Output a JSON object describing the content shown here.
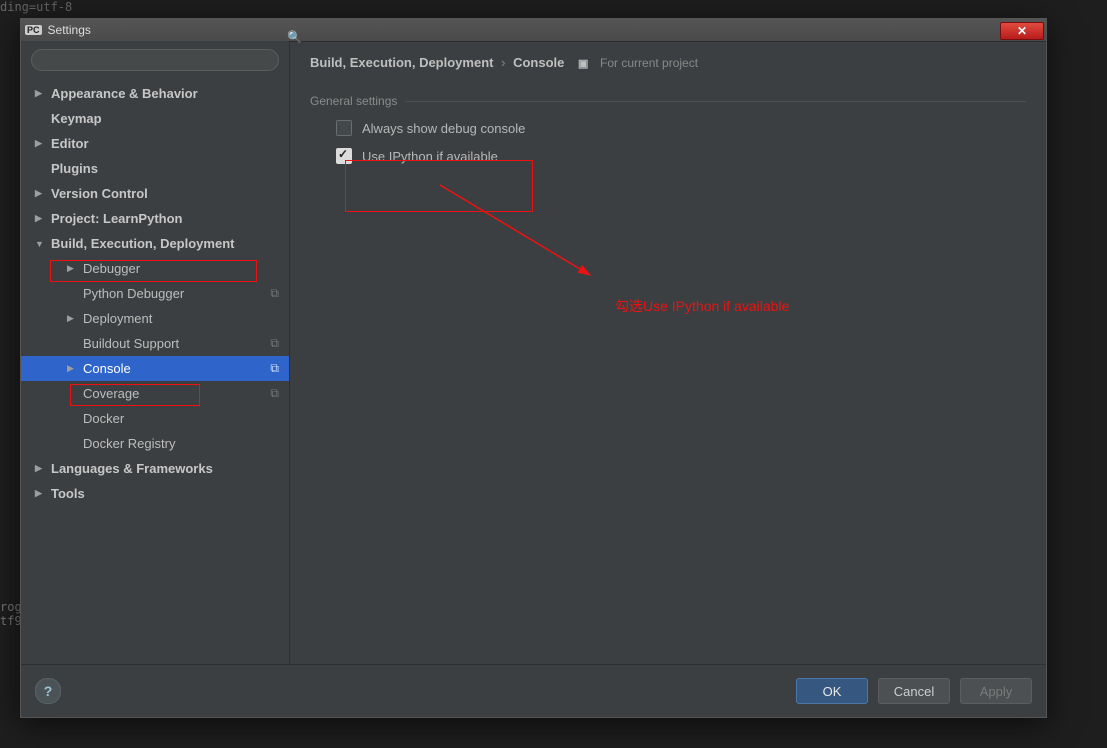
{
  "background": {
    "top_fragment": "ding=utf-8",
    "bottom1": "rog",
    "bottom2": "tf9"
  },
  "dialog": {
    "title": "Settings",
    "close_glyph": "✕"
  },
  "search": {
    "placeholder": ""
  },
  "tree": {
    "appearance": "Appearance & Behavior",
    "keymap": "Keymap",
    "editor": "Editor",
    "plugins": "Plugins",
    "vcs": "Version Control",
    "project": "Project: LearnPython",
    "build": "Build, Execution, Deployment",
    "debugger": "Debugger",
    "python_debugger": "Python Debugger",
    "deployment": "Deployment",
    "buildout": "Buildout Support",
    "console": "Console",
    "coverage": "Coverage",
    "docker": "Docker",
    "docker_registry": "Docker Registry",
    "langfw": "Languages & Frameworks",
    "tools": "Tools",
    "badge": "⧉"
  },
  "breadcrumb": {
    "a": "Build, Execution, Deployment",
    "b": "Console",
    "project_hint": "For current project"
  },
  "panel": {
    "section": "General settings",
    "opt_debug": "Always show debug console",
    "opt_ipython": "Use IPython if available"
  },
  "annotation": {
    "text": "勾选Use IPython if available"
  },
  "buttons": {
    "ok": "OK",
    "cancel": "Cancel",
    "apply": "Apply",
    "help": "?"
  }
}
